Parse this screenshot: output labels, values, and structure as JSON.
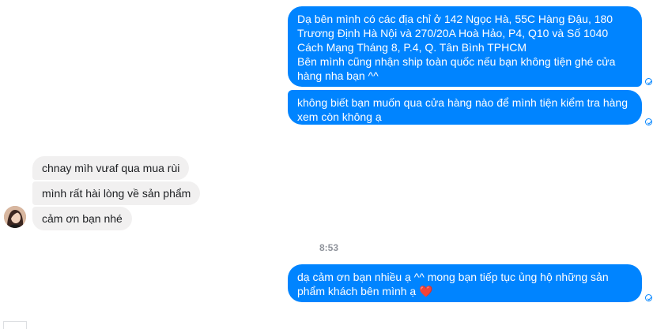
{
  "messages": {
    "m1": "Dạ bên mình có các địa chỉ ở 142 Ngọc Hà, 55C Hàng Đậu, 180 Trương Định Hà Nội và 270/20A Hoà Hảo, P4, Q10 và Số 1040 Cách Mạng Tháng 8, P.4, Q. Tân Bình TPHCM\nBên mình cũng nhận ship toàn quốc nếu bạn không tiện ghé cửa hàng nha bạn ^^",
    "m2": "không biết bạn muốn qua cửa hàng nào để mình tiện kiểm tra hàng xem còn không ạ",
    "m3": "chnay mìh vưaf qua mua rùi",
    "m4": "mình rất hài lòng về sản phẩm",
    "m5": "cảm ơn bạn nhé",
    "m6": "dạ cảm ơn bạn nhiều ạ ^^ mong bạn tiếp tục ủng hộ những sản phẩm khách bên mình ạ ",
    "m6_emoji": "❤️"
  },
  "timestamp": "8:53",
  "colors": {
    "outgoing_bubble": "#0084ff",
    "incoming_bubble": "#f1f0f0",
    "timestamp": "#90949c"
  },
  "icons": {
    "sent_status": "check-circle-icon",
    "heart": "heart-icon"
  }
}
